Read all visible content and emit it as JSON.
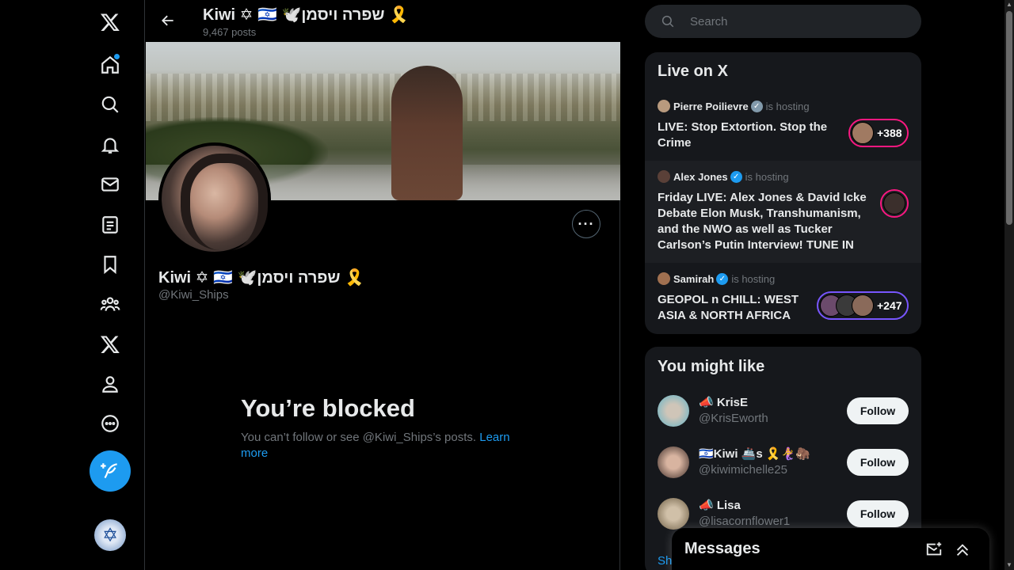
{
  "nav": {
    "items": [
      {
        "name": "logo",
        "icon": "x-logo-icon"
      },
      {
        "name": "home",
        "icon": "home-icon",
        "notification_dot": true
      },
      {
        "name": "explore",
        "icon": "search-icon"
      },
      {
        "name": "notifications",
        "icon": "bell-icon"
      },
      {
        "name": "messages",
        "icon": "envelope-icon"
      },
      {
        "name": "lists",
        "icon": "list-icon"
      },
      {
        "name": "bookmarks",
        "icon": "bookmark-icon"
      },
      {
        "name": "communities",
        "icon": "people-icon"
      },
      {
        "name": "premium",
        "icon": "x-logo-icon"
      },
      {
        "name": "profile",
        "icon": "person-icon"
      },
      {
        "name": "more",
        "icon": "more-circle-icon"
      }
    ],
    "post_button_icon": "feather-plus-icon",
    "account_avatar_icon": "star-of-david-icon"
  },
  "header": {
    "name": "Kiwi ✡ 🇮🇱 🕊️שפרה ויסמן 🎗️",
    "posts": "9,467 posts"
  },
  "profile": {
    "name": "Kiwi ✡ 🇮🇱 🕊️שפרה ויסמן 🎗️",
    "handle": "@Kiwi_Ships",
    "more_label": "···"
  },
  "blocked": {
    "title": "You’re blocked",
    "text": "You can’t follow or see @Kiwi_Ships’s posts.",
    "link": "Learn more"
  },
  "search": {
    "placeholder": "Search"
  },
  "live": {
    "title": "Live on X",
    "items": [
      {
        "host": "Pierre Poilievre",
        "verified": "gray",
        "hosting": "is hosting",
        "title": "LIVE: Stop Extortion. Stop the Crime",
        "count": "+388",
        "pill_color": "#f91880"
      },
      {
        "host": "Alex Jones",
        "verified": "blue",
        "hosting": "is hosting",
        "title": "Friday LIVE: Alex Jones & David Icke Debate Elon Musk, Transhumanism, and the NWO as well as Tucker Carlson’s Putin Interview! TUNE IN",
        "count": "",
        "pill_color": "#f91880"
      },
      {
        "host": "Samirah",
        "verified": "blue",
        "hosting": "is hosting",
        "title": "GEOPOL n CHILL: WEST ASIA & NORTH AFRICA",
        "count": "+247",
        "pill_color": "#7856ff"
      }
    ]
  },
  "suggestions": {
    "title": "You might like",
    "items": [
      {
        "name": "📣 KrisE",
        "handle": "@KrisEworth",
        "button": "Follow"
      },
      {
        "name": "🇮🇱Kiwi 🚢s 🎗️🧜‍♀️🦣",
        "handle": "@kiwimichelle25",
        "button": "Follow"
      },
      {
        "name": "📣 Lisa",
        "handle": "@lisacornflower1",
        "button": "Follow"
      }
    ],
    "show_more": "Sh"
  },
  "messages_drawer": {
    "title": "Messages",
    "compose_icon": "new-message-icon",
    "expand_icon": "double-chevron-up-icon"
  }
}
